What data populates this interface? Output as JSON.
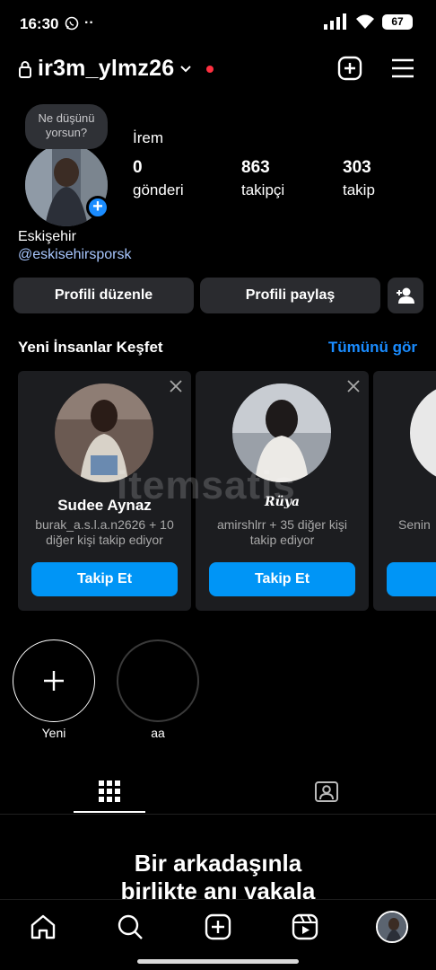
{
  "status_bar": {
    "time": "16:30",
    "extra": "··",
    "battery": "67"
  },
  "header": {
    "username": "ir3m_ylmz26",
    "lock_icon": "lock-icon",
    "create_icon": "plus-square-icon",
    "menu_icon": "hamburger-icon",
    "notification_color": "#ff3040"
  },
  "profile": {
    "note": "Ne düşünü yorsun?",
    "name": "İrem",
    "stats": [
      {
        "value": "0",
        "label": "gönderi"
      },
      {
        "value": "863",
        "label": "takipçi"
      },
      {
        "value": "303",
        "label": "takip"
      }
    ],
    "bio_city": "Eskişehir",
    "bio_link": "@eskisehirsporsk",
    "edit_button": "Profili düzenle",
    "share_button": "Profili paylaş"
  },
  "discover": {
    "title": "Yeni İnsanlar Keşfet",
    "see_all": "Tümünü gör",
    "cards": [
      {
        "name": "Sudee Aynaz",
        "sub": "burak_a.s.l.a.n2626 + 10 diğer kişi takip ediyor",
        "follow": "Takip Et"
      },
      {
        "name": "",
        "overlay": "Rüya",
        "sub": "amirshlrr + 35 diğer kişi takip ediyor",
        "follow": "Takip Et"
      },
      {
        "name": "",
        "sub": "Senin",
        "follow": "T"
      }
    ]
  },
  "watermark": "itemsatis",
  "highlights": [
    {
      "label": "Yeni"
    },
    {
      "label": "aa"
    }
  ],
  "tabs": {
    "grid_icon": "grid-icon",
    "tagged_icon": "tagged-person-icon"
  },
  "empty_state": {
    "title": "Bir arkadaşınla birlikte anı yakala"
  },
  "bottom_nav": [
    "home-icon",
    "search-icon",
    "create-icon",
    "reels-icon",
    "profile-avatar"
  ],
  "colors": {
    "accent": "#0095f6",
    "link": "#a8c7ff",
    "card_bg": "#1c1d20",
    "button_bg": "#2a2b2f"
  }
}
